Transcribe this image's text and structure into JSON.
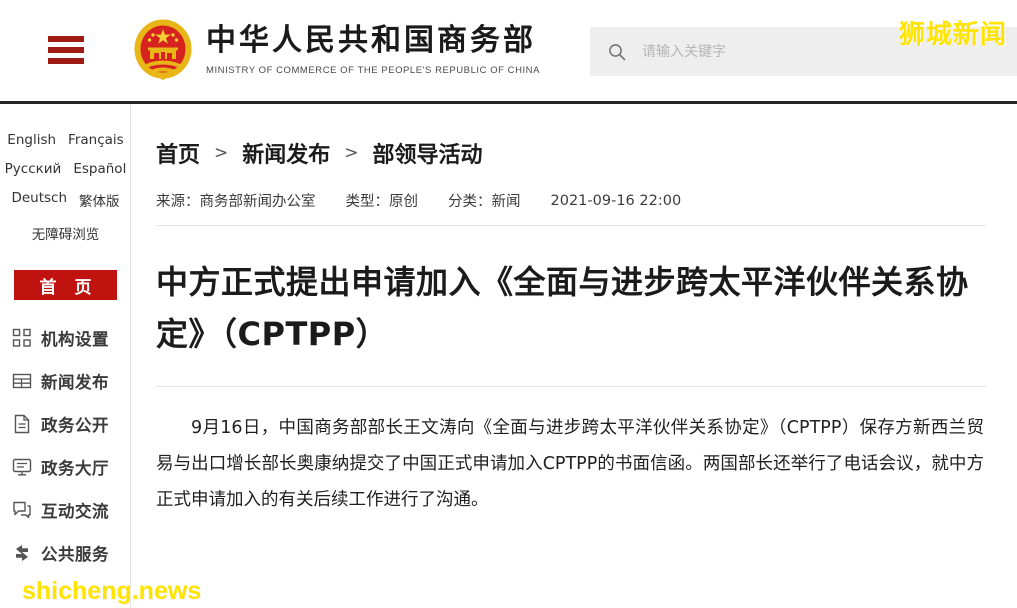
{
  "header": {
    "menu_icon": "hamburger-menu-icon",
    "emblem_alt": "national-emblem-of-china",
    "brand_cn": "中华人民共和国商务部",
    "brand_en": "MINISTRY OF COMMERCE OF THE PEOPLE'S REPUBLIC OF CHINA",
    "search": {
      "icon": "search-icon",
      "placeholder": "请输入关键字",
      "value": ""
    },
    "watermark": "狮城新闻"
  },
  "sidebar": {
    "languages_row1": [
      {
        "label": "English"
      },
      {
        "label": "Français"
      }
    ],
    "languages_row2": [
      {
        "label": "Русский"
      },
      {
        "label": "Español"
      }
    ],
    "languages_row3": [
      {
        "label": "Deutsch"
      },
      {
        "label": "繁体版"
      }
    ],
    "accessibility": "无障碍浏览",
    "home": {
      "label": "首 页",
      "active": true,
      "color": "#c0130f"
    },
    "items": [
      {
        "label": "机构设置",
        "icon": "apps-grid-icon"
      },
      {
        "label": "新闻发布",
        "icon": "news-list-icon"
      },
      {
        "label": "政务公开",
        "icon": "document-icon"
      },
      {
        "label": "政务大厅",
        "icon": "monitor-icon"
      },
      {
        "label": "互动交流",
        "icon": "chat-bubble-icon"
      },
      {
        "label": "公共服务",
        "icon": "share-swap-icon"
      }
    ],
    "watermark": "shicheng.news"
  },
  "main": {
    "breadcrumb": [
      {
        "label": "首页"
      },
      {
        "label": "新闻发布"
      },
      {
        "label": "部领导活动"
      }
    ],
    "breadcrumb_separator": "〉",
    "meta": {
      "source": "来源：商务部新闻办公室",
      "type": "类型：原创",
      "category": "分类：新闻",
      "datetime": "2021-09-16 22:00"
    },
    "title": "中方正式提出申请加入《全面与进步跨太平洋伙伴关系协定》（CPTPP）",
    "paragraph": "9月16日，中国商务部部长王文涛向《全面与进步跨太平洋伙伴关系协定》（CPTPP）保存方新西兰贸易与出口增长部长奥康纳提交了中国正式申请加入CPTPP的书面信函。两国部长还举行了电话会议，就中方正式申请加入的有关后续工作进行了沟通。"
  },
  "colors": {
    "brand_red": "#c0130f",
    "menu_red": "#9e1b16",
    "rule_dark": "#262626",
    "watermark_yellow": "#ffe400"
  }
}
